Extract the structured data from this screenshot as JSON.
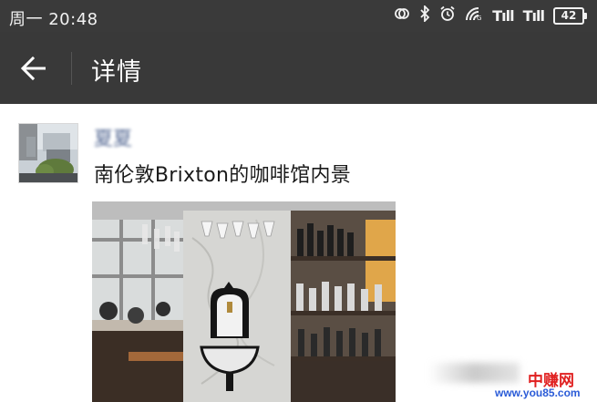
{
  "status_bar": {
    "time": "周一 20:48",
    "signal_label": "Tıll",
    "signal_label_2": "Tıll",
    "battery": "42",
    "icons": [
      "sync-icon",
      "bluetooth-icon",
      "alarm-icon",
      "wifi-icon"
    ]
  },
  "app_bar": {
    "back_icon": "arrow-left-icon",
    "title": "详情"
  },
  "post": {
    "author": "夏夏",
    "text": "南伦敦Brixton的咖啡馆内景",
    "image_alt": "cafe-interior-photo"
  },
  "watermark": {
    "brand": "中赚网",
    "url": "www.you85.com"
  },
  "colors": {
    "status_bar_bg": "#3a3a3a",
    "app_bar_bg": "#393939",
    "author_link": "#576b95",
    "watermark_red": "#e02020",
    "watermark_blue": "#2a5bd7"
  }
}
